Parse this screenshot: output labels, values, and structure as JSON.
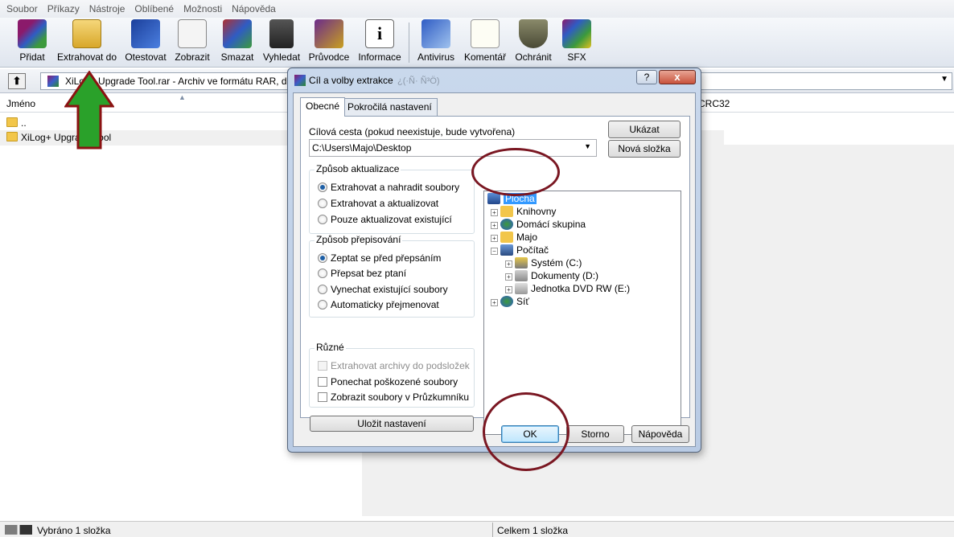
{
  "menu": [
    "Soubor",
    "Příkazy",
    "Nástroje",
    "Oblíbené",
    "Možnosti",
    "Nápověda"
  ],
  "toolbar": [
    {
      "label": "Přidat",
      "icon": "add-archive-icon"
    },
    {
      "label": "Extrahovat do",
      "icon": "extract-to-icon"
    },
    {
      "label": "Otestovat",
      "icon": "test-archive-icon"
    },
    {
      "label": "Zobrazit",
      "icon": "view-glasses-icon"
    },
    {
      "label": "Smazat",
      "icon": "delete-icon"
    },
    {
      "label": "Vyhledat",
      "icon": "find-binoculars-icon"
    },
    {
      "label": "Průvodce",
      "icon": "wizard-icon"
    },
    {
      "label": "Informace",
      "icon": "info-icon"
    },
    {
      "label": "Antivirus",
      "icon": "antivirus-icon"
    },
    {
      "label": "Komentář",
      "icon": "comment-icon"
    },
    {
      "label": "Ochránit",
      "icon": "protect-shield-icon"
    },
    {
      "label": "SFX",
      "icon": "sfx-icon"
    }
  ],
  "address": {
    "path": "XiLog+ Upgrade Tool.rar - Archiv ve formátu RAR, d"
  },
  "filelist": {
    "col_name": "Jméno",
    "col_crc": "CRC32",
    "rows": [
      {
        "name": ".."
      },
      {
        "name": "XiLog+ Upgrade Tool"
      }
    ]
  },
  "statusbar": {
    "left": "Vybráno 1 složka",
    "right": "Celkem 1 složka"
  },
  "dialog": {
    "title": "Cíl a volby extrakce",
    "title_faded": "¿(·Ñ· Ñ³Ö)",
    "help": "?",
    "close": "x",
    "tabs": [
      "Obecné",
      "Pokročilá nastavení"
    ],
    "dest_label": "Cílová cesta (pokud neexistuje, bude vytvořena)",
    "dest_value": "C:\\Users\\Majo\\Desktop",
    "btn_show": "Ukázat",
    "btn_newfolder": "Nová složka",
    "update_group": {
      "title": "Způsob aktualizace",
      "options": [
        "Extrahovat a nahradit soubory",
        "Extrahovat a aktualizovat",
        "Pouze aktualizovat existující"
      ],
      "selected": 0
    },
    "overwrite_group": {
      "title": "Způsob přepisování",
      "options": [
        "Zeptat se před přepsáním",
        "Přepsat bez ptaní",
        "Vynechat existující soubory",
        "Automaticky přejmenovat"
      ],
      "selected": 0
    },
    "misc_group": {
      "title": "Různé",
      "options": [
        "Extrahovat archivy do podsložek",
        "Ponechat poškozené soubory",
        "Zobrazit soubory v Průzkumníku"
      ]
    },
    "btn_save": "Uložit nastavení",
    "tree": [
      "Plocha",
      "Knihovny",
      "Domácí skupina",
      "Majo",
      "Počítač",
      "Systém (C:)",
      "Dokumenty (D:)",
      "Jednotka DVD RW (E:)",
      "Síť"
    ],
    "btn_ok": "OK",
    "btn_cancel": "Storno",
    "btn_help": "Nápověda"
  }
}
